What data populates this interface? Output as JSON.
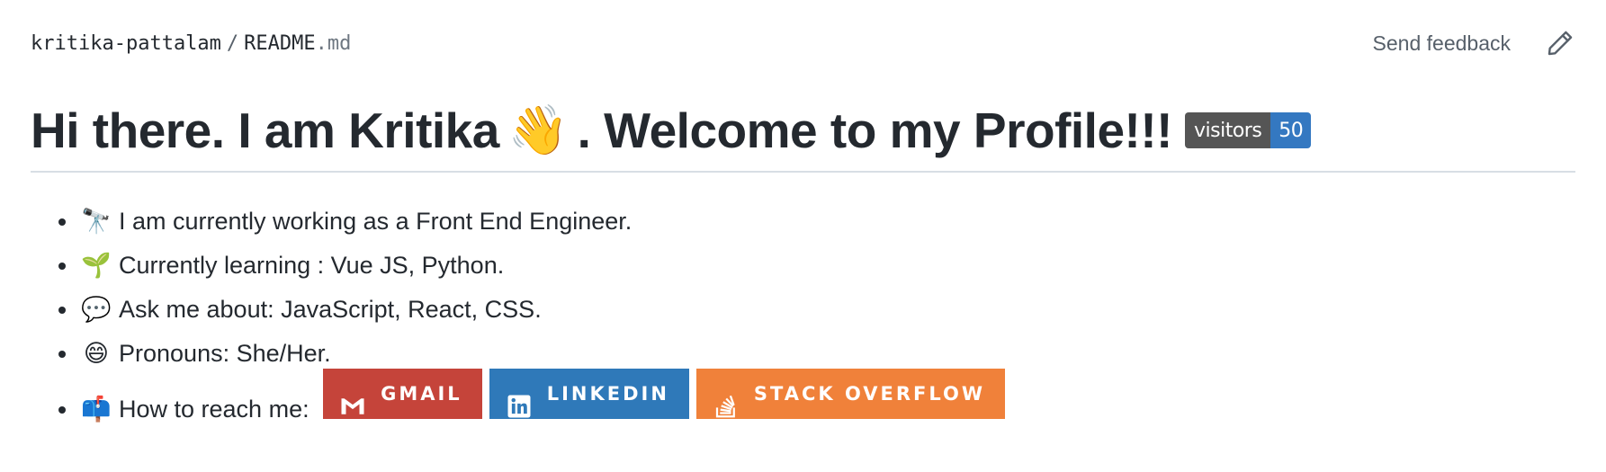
{
  "breadcrumb": {
    "owner": "kritika-pattalam",
    "separator": "/",
    "file_name": "README",
    "file_ext": ".md"
  },
  "actions": {
    "feedback_label": "Send feedback",
    "edit_icon": "pencil-icon"
  },
  "headline": {
    "text_before": "Hi there. I am Kritika",
    "wave_emoji": "👋",
    "text_after": ". Welcome to my Profile!!!",
    "badge_label": "visitors",
    "badge_value": "50",
    "badge_label_color": "#555555",
    "badge_value_color": "#3478c1"
  },
  "bullets": [
    {
      "emoji": "🔭",
      "text": "I am currently working as a Front End Engineer."
    },
    {
      "emoji": "🌱",
      "text": "Currently learning : Vue JS, Python."
    },
    {
      "emoji": "💬",
      "text": "Ask me about: JavaScript, React, CSS."
    },
    {
      "emoji": "😄",
      "text": "Pronouns: She/Her."
    },
    {
      "emoji": "📫",
      "text": "How to reach me:"
    }
  ],
  "social": [
    {
      "label": "GMAIL",
      "icon": "gmail-icon",
      "color": "#c5443a"
    },
    {
      "label": "LINKEDIN",
      "icon": "linkedin-icon",
      "color": "#2f79b9"
    },
    {
      "label": "STACK OVERFLOW",
      "icon": "stackoverflow-icon",
      "color": "#f0813a"
    }
  ]
}
